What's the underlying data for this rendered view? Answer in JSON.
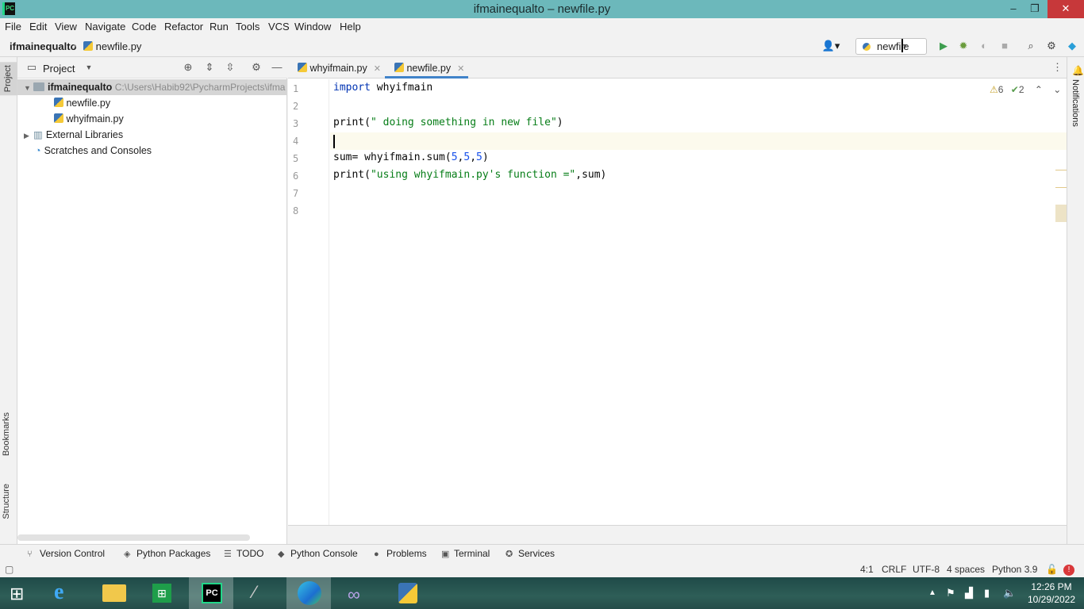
{
  "window": {
    "title": "ifmainequalto – newfile.py",
    "min": "–",
    "max": "❐",
    "close": "✕"
  },
  "menu": [
    "File",
    "Edit",
    "View",
    "Navigate",
    "Code",
    "Refactor",
    "Run",
    "Tools",
    "VCS",
    "Window",
    "Help"
  ],
  "breadcrumb": {
    "project": "ifmainequalto",
    "file": "newfile.py"
  },
  "run_config": {
    "name": "newfile"
  },
  "project_panel": {
    "title": "Project",
    "root": "ifmainequalto",
    "root_path": "C:\\Users\\Habib92\\PycharmProjects\\ifma",
    "files": [
      "newfile.py",
      "whyifmain.py"
    ],
    "external": "External Libraries",
    "scratches": "Scratches and Consoles"
  },
  "left_tabs": {
    "project": "Project",
    "bookmarks": "Bookmarks",
    "structure": "Structure"
  },
  "right_tabs": {
    "notifications": "Notifications"
  },
  "editor_tabs": [
    {
      "label": "whyifmain.py"
    },
    {
      "label": "newfile.py",
      "active": true
    }
  ],
  "inspections": {
    "warnings": "6",
    "weak": "2"
  },
  "code": {
    "line_numbers": [
      "1",
      "2",
      "3",
      "4",
      "5",
      "6",
      "7",
      "8"
    ],
    "l1_kw": "import",
    "l1_rest": " whyifmain",
    "l3_fn": "print(",
    "l3_str": "\" doing something in new file\"",
    "l3_end": ")",
    "l5_a": "sum= whyifmain.sum(",
    "l5_n1": "5",
    "l5_c1": ",",
    "l5_n2": "5",
    "l5_c2": ",",
    "l5_n3": "5",
    "l5_end": ")",
    "l6_fn": "print(",
    "l6_str": "\"using whyifmain.py's function =\"",
    "l6_end": ",sum)"
  },
  "bottom_tools": [
    "Version Control",
    "Python Packages",
    "TODO",
    "Python Console",
    "Problems",
    "Terminal",
    "Services"
  ],
  "status": {
    "position": "4:1",
    "line_sep": "CRLF",
    "encoding": "UTF-8",
    "indent": "4 spaces",
    "interpreter": "Python 3.9"
  },
  "clock": {
    "time": "12:26 PM",
    "date": "10/29/2022"
  },
  "colors": {
    "titlebar": "#6cb8bb",
    "accent": "#4083c9",
    "keyword": "#0033b3",
    "string": "#067d17",
    "number": "#1750eb"
  }
}
